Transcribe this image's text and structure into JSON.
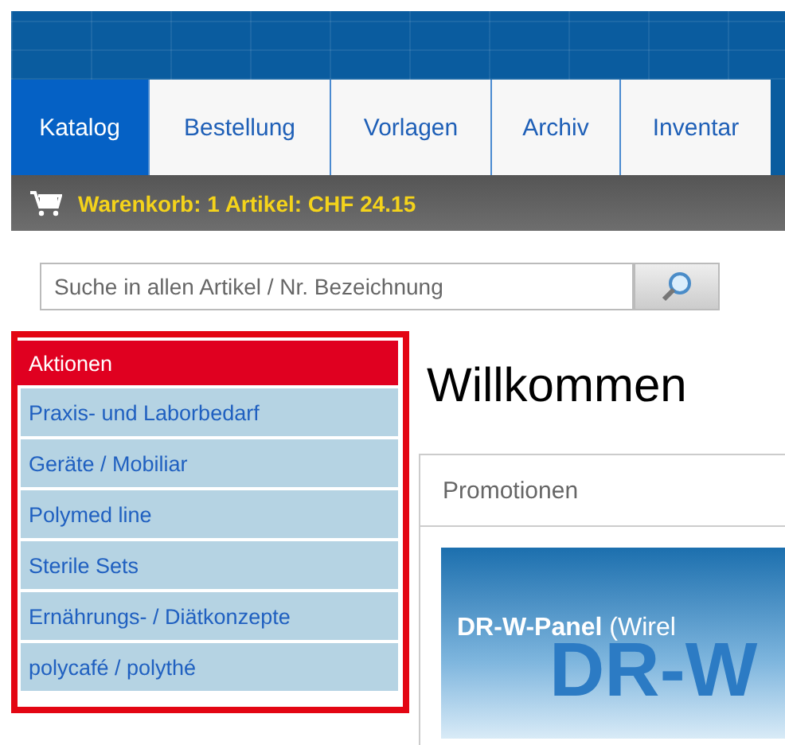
{
  "tabs": [
    {
      "label": "Katalog",
      "selected": true
    },
    {
      "label": "Bestellung",
      "selected": false
    },
    {
      "label": "Vorlagen",
      "selected": false
    },
    {
      "label": "Archiv",
      "selected": false
    },
    {
      "label": "Inventar",
      "selected": false
    }
  ],
  "cart": {
    "text": "Warenkorb: 1 Artikel: CHF 24.15"
  },
  "search": {
    "placeholder": "Suche in allen Artikel / Nr. Bezeichnung"
  },
  "sidebar": {
    "items": [
      {
        "label": "Aktionen",
        "selected": true
      },
      {
        "label": "Praxis- und Laborbedarf",
        "selected": false
      },
      {
        "label": "Geräte / Mobiliar",
        "selected": false
      },
      {
        "label": "Polymed line",
        "selected": false
      },
      {
        "label": "Sterile Sets",
        "selected": false
      },
      {
        "label": "Ernährungs- / Diätkonzepte",
        "selected": false
      },
      {
        "label": "polycafé / polythé",
        "selected": false
      }
    ]
  },
  "heading": "Willkommen",
  "promotions": {
    "title": "Promotionen",
    "banner_caption": "**DR-W-Panel** (Wirel",
    "banner_big": "DR-W"
  }
}
